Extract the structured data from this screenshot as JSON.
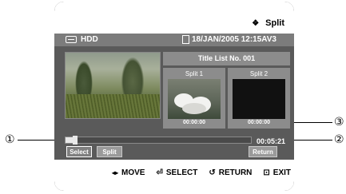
{
  "header": {
    "mode_icon": "diamond-cursor-icon",
    "mode_title": "Split"
  },
  "info": {
    "source_icon": "hdd-icon",
    "source": "HDD",
    "date_icon": "document-icon",
    "datetime": "18/JAN/2005 12:15AV3"
  },
  "title_list": {
    "label": "Title List No. 001"
  },
  "splits": [
    {
      "label": "Split 1",
      "time": "00:00:00"
    },
    {
      "label": "Split 2",
      "time": "00:00:00"
    }
  ],
  "progress": {
    "fraction": 0.05,
    "timecode": "00:05:21"
  },
  "buttons": {
    "select": "Select",
    "split": "Split",
    "return": "Return"
  },
  "footer": {
    "move": "MOVE",
    "select": "SELECT",
    "return": "RETURN",
    "exit": "EXIT",
    "move_icon": "left-right-arrows-icon",
    "select_icon": "enter-icon",
    "return_icon": "return-arrow-icon",
    "exit_icon": "exit-icon"
  },
  "callouts": {
    "one": "①",
    "two": "②",
    "three": "③"
  }
}
